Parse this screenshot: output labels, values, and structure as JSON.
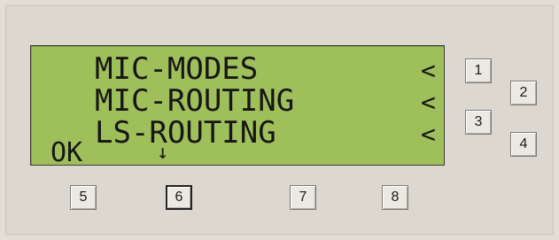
{
  "lcd": {
    "lines": [
      {
        "text": "MIC-MODES",
        "marker": "<"
      },
      {
        "text": "MIC-ROUTING",
        "marker": "<"
      },
      {
        "text": "LS-ROUTING",
        "marker": "<"
      }
    ],
    "softkey_left": "OK",
    "softkey_down": "↓",
    "background_color": "#9fbf5a"
  },
  "buttons": {
    "b1": "1",
    "b2": "2",
    "b3": "3",
    "b4": "4",
    "b5": "5",
    "b6": "6",
    "b7": "7",
    "b8": "8"
  }
}
